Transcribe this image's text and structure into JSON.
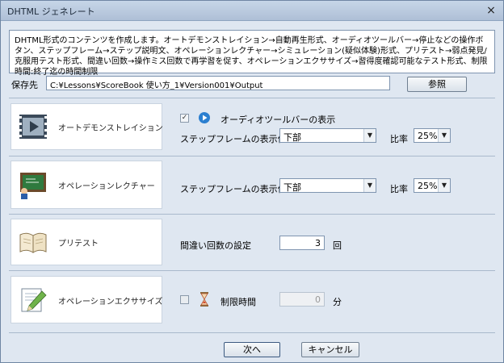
{
  "window": {
    "title": "DHTML ジェネレート",
    "close": "×"
  },
  "description": "DHTML形式のコンテンツを作成します。オートデモンストレイション→自動再生形式、オーディオツールバー→停止などの操作ボタン、ステップフレーム→ステップ説明文、オペレーションレクチャー→シミュレーション(疑似体験)形式、プリテスト→弱点発見/克服用テスト形式、間違い回数→操作ミス回数で再学習を促す、オペレーションエクササイズ→習得度確認可能なテスト形式、制限時間:終了迄の時間制限",
  "save": {
    "label": "保存先",
    "path": "C:¥Lessons¥ScoreBook 使い方_1¥Version001¥Output",
    "browse": "参照"
  },
  "sections": {
    "auto_demo": {
      "label": "オートデモンストレイション",
      "audio_toolbar_label": "オーディオツールバーの表示",
      "audio_toolbar_checked": "✓",
      "step_frame_label": "ステップフレームの表示位置",
      "step_frame_value": "下部",
      "ratio_label": "比率",
      "ratio_value": "25%"
    },
    "op_lecture": {
      "label": "オペレーションレクチャー",
      "step_frame_label": "ステップフレームの表示位置",
      "step_frame_value": "下部",
      "ratio_label": "比率",
      "ratio_value": "25%"
    },
    "pretest": {
      "label": "プリテスト",
      "mistakes_label": "間違い回数の設定",
      "mistakes_value": "3",
      "mistakes_unit": "回"
    },
    "op_exercise": {
      "label": "オペレーションエクササイズ",
      "time_limit_label": "制限時間",
      "time_limit_value": "0",
      "time_limit_unit": "分"
    }
  },
  "footer": {
    "next": "次へ",
    "cancel": "キャンセル"
  },
  "icons": {
    "dropdown": "▼",
    "play": "▶"
  }
}
